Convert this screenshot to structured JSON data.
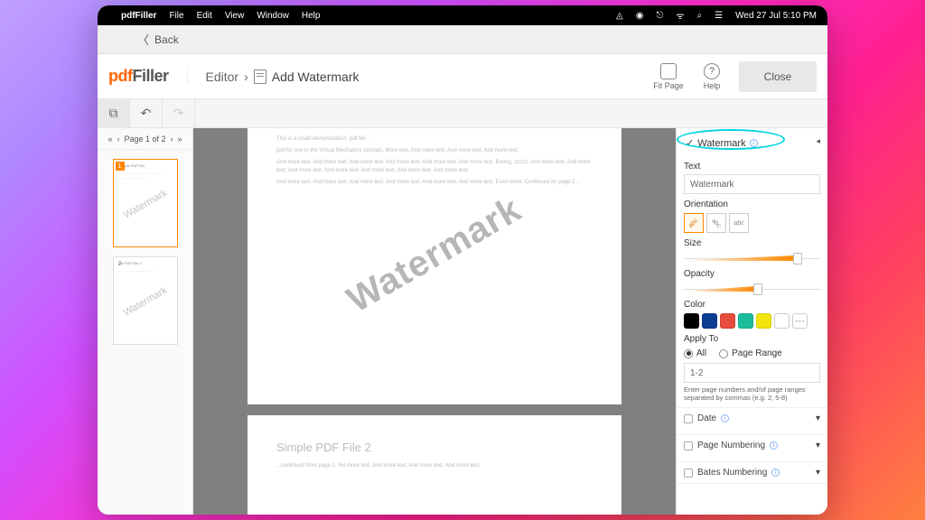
{
  "menubar": {
    "app": "pdfFiller",
    "items": [
      "File",
      "Edit",
      "View",
      "Window",
      "Help"
    ],
    "datetime": "Wed 27 Jul  5:10 PM"
  },
  "titlebar": {
    "back": "Back"
  },
  "logo": {
    "p1": "pdf",
    "p2": "Filler"
  },
  "breadcrumb": {
    "a": "Editor",
    "b": "Add Watermark"
  },
  "header": {
    "fitpage": "Fit Page",
    "help": "Help",
    "close": "Close"
  },
  "pager": {
    "label": "Page 1 of 2"
  },
  "thumbs": [
    {
      "num": "1",
      "title": "Simple PDF File",
      "wm": "Watermark"
    },
    {
      "num": "2",
      "title": "ple PDF File 2",
      "wm": "Watermark"
    }
  ],
  "canvas": {
    "wm": "Watermark",
    "page2_title": "Simple PDF File 2"
  },
  "panel": {
    "title": "Watermark",
    "text_label": "Text",
    "text_value": "Watermark",
    "orientation_label": "Orientation",
    "orient_opts": [
      "abc",
      "abc",
      "abc"
    ],
    "size_label": "Size",
    "opacity_label": "Opacity",
    "color_label": "Color",
    "colors": [
      "#000000",
      "#0b3d91",
      "#e74c3c",
      "#1abc9c",
      "#f1e40f",
      "#ffffff"
    ],
    "apply_label": "Apply To",
    "apply_all": "All",
    "apply_range": "Page Range",
    "range_value": "1-2",
    "range_hint": "Enter page numbers and/of page ranges separated by commas (e.g. 2, 5-8)",
    "acc_date": "Date",
    "acc_pagenum": "Page Numbering",
    "acc_bates": "Bates Numbering"
  }
}
